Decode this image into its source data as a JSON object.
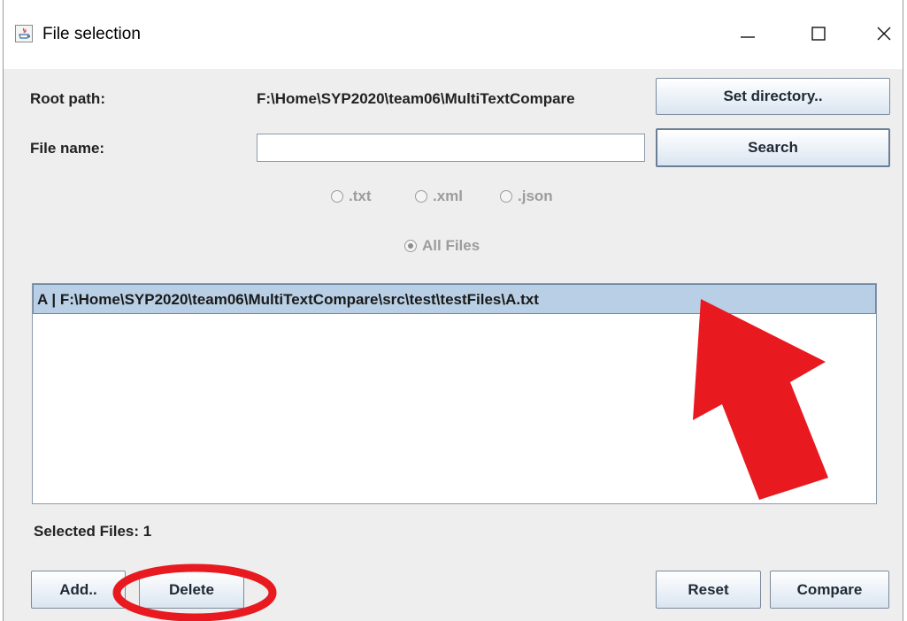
{
  "window": {
    "title": "File selection",
    "icons": [
      "java-app-icon",
      "minimize-icon",
      "maximize-icon",
      "close-icon"
    ]
  },
  "form": {
    "root_path_label": "Root path:",
    "root_path_value": "F:\\Home\\SYP2020\\team06\\MultiTextCompare",
    "set_directory_label": "Set directory..",
    "file_name_label": "File name:",
    "file_name_value": "",
    "search_label": "Search"
  },
  "filters": {
    "options": [
      ".txt",
      ".xml",
      ".json"
    ],
    "all_files_label": "All Files",
    "selected": "All Files"
  },
  "file_list": {
    "items": [
      "A |  F:\\Home\\SYP2020\\team06\\MultiTextCompare\\src\\test\\testFiles\\A.txt"
    ]
  },
  "status": {
    "selected_files_text": "Selected Files:  1"
  },
  "buttons": {
    "add": "Add..",
    "delete": "Delete",
    "reset": "Reset",
    "compare": "Compare"
  },
  "annotations": {
    "arrow_color": "#e8191f",
    "circle_color": "#e8191f"
  }
}
